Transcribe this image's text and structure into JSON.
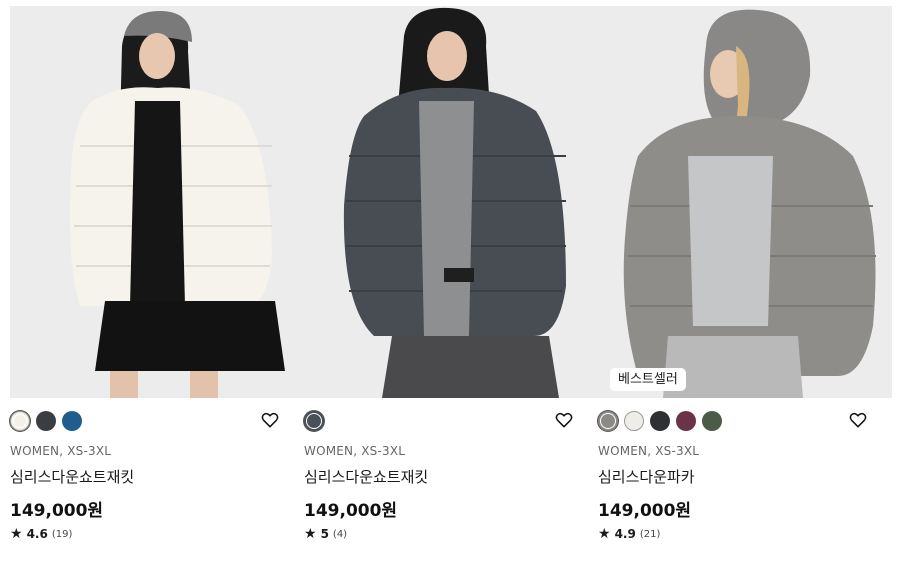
{
  "products": [
    {
      "badge": "",
      "swatches": [
        {
          "color": "#f4f1ea",
          "selected": true
        },
        {
          "color": "#3a3d42",
          "selected": false
        },
        {
          "color": "#1f5d8c",
          "selected": false
        }
      ],
      "meta": "WOMEN, XS-3XL",
      "name": "심리스다운쇼트재킷",
      "price": "149,000원",
      "rating": "4.6",
      "reviews": "(19)"
    },
    {
      "badge": "",
      "swatches": [
        {
          "color": "#4a5058",
          "selected": true
        }
      ],
      "meta": "WOMEN, XS-3XL",
      "name": "심리스다운쇼트재킷",
      "price": "149,000원",
      "rating": "5",
      "reviews": "(4)"
    },
    {
      "badge": "베스트셀러",
      "swatches": [
        {
          "color": "#8c8a87",
          "selected": true
        },
        {
          "color": "#efede7",
          "selected": false
        },
        {
          "color": "#2e3033",
          "selected": false
        },
        {
          "color": "#6b3348",
          "selected": false
        },
        {
          "color": "#4c5a48",
          "selected": false
        }
      ],
      "meta": "WOMEN, XS-3XL",
      "name": "심리스다운파카",
      "price": "149,000원",
      "rating": "4.9",
      "reviews": "(21)"
    }
  ],
  "icons": {
    "favorite": "heart-outline-icon",
    "rating": "star-icon"
  },
  "colors": {
    "text": "#1a1a1a",
    "meta": "#666666"
  }
}
